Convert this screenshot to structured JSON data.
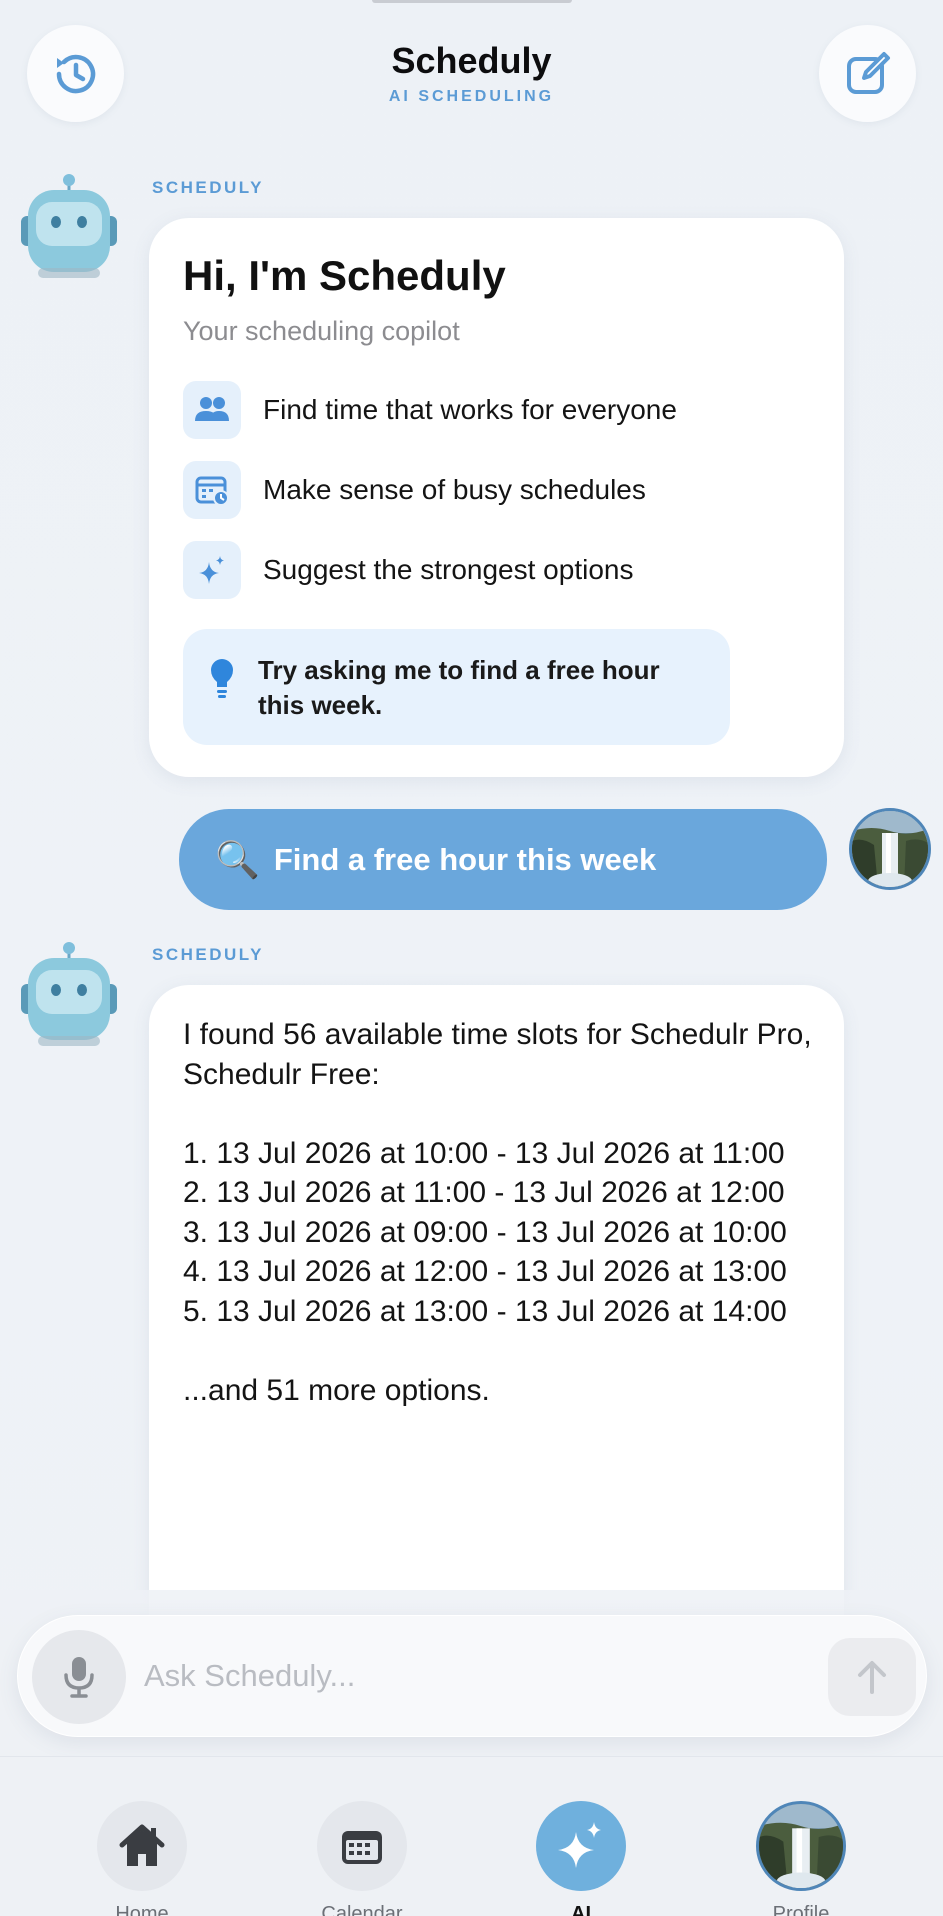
{
  "header": {
    "title": "Scheduly",
    "subtitle": "AI SCHEDULING",
    "history_icon": "history-icon",
    "compose_icon": "compose-icon"
  },
  "welcome": {
    "sender": "SCHEDULY",
    "title": "Hi, I'm Scheduly",
    "subtitle": "Your scheduling copilot",
    "features": [
      {
        "icon": "people-icon",
        "text": "Find time that works for everyone"
      },
      {
        "icon": "calendar-busy-icon",
        "text": "Make sense of busy schedules"
      },
      {
        "icon": "sparkle-icon",
        "text": "Suggest the strongest options"
      }
    ],
    "tip": "Try asking me to find a free hour this week."
  },
  "user_message": {
    "emoji": "🔍",
    "text": "Find a free hour this week"
  },
  "response": {
    "sender": "SCHEDULY",
    "text": "I found 56 available time slots for Schedulr Pro, Schedulr Free:\n\n1. 13 Jul 2026 at 10:00 - 13 Jul 2026 at 11:00\n2. 13 Jul 2026 at 11:00 - 13 Jul 2026 at 12:00\n3. 13 Jul 2026 at 09:00 - 13 Jul 2026 at 10:00\n4. 13 Jul 2026 at 12:00 - 13 Jul 2026 at 13:00\n5. 13 Jul 2026 at 13:00 - 13 Jul 2026 at 14:00\n\n...and 51 more options."
  },
  "input": {
    "placeholder": "Ask Scheduly...",
    "value": ""
  },
  "tabs": [
    {
      "label": "Home",
      "icon": "home-icon"
    },
    {
      "label": "Calendar",
      "icon": "calendar-icon"
    },
    {
      "label": "AI",
      "icon": "sparkle-icon"
    },
    {
      "label": "Profile",
      "icon": "profile-avatar"
    }
  ],
  "colors": {
    "accent": "#5b9bd5",
    "bubble": "#6aa7dc",
    "tab_active": "#6fb0dd"
  }
}
